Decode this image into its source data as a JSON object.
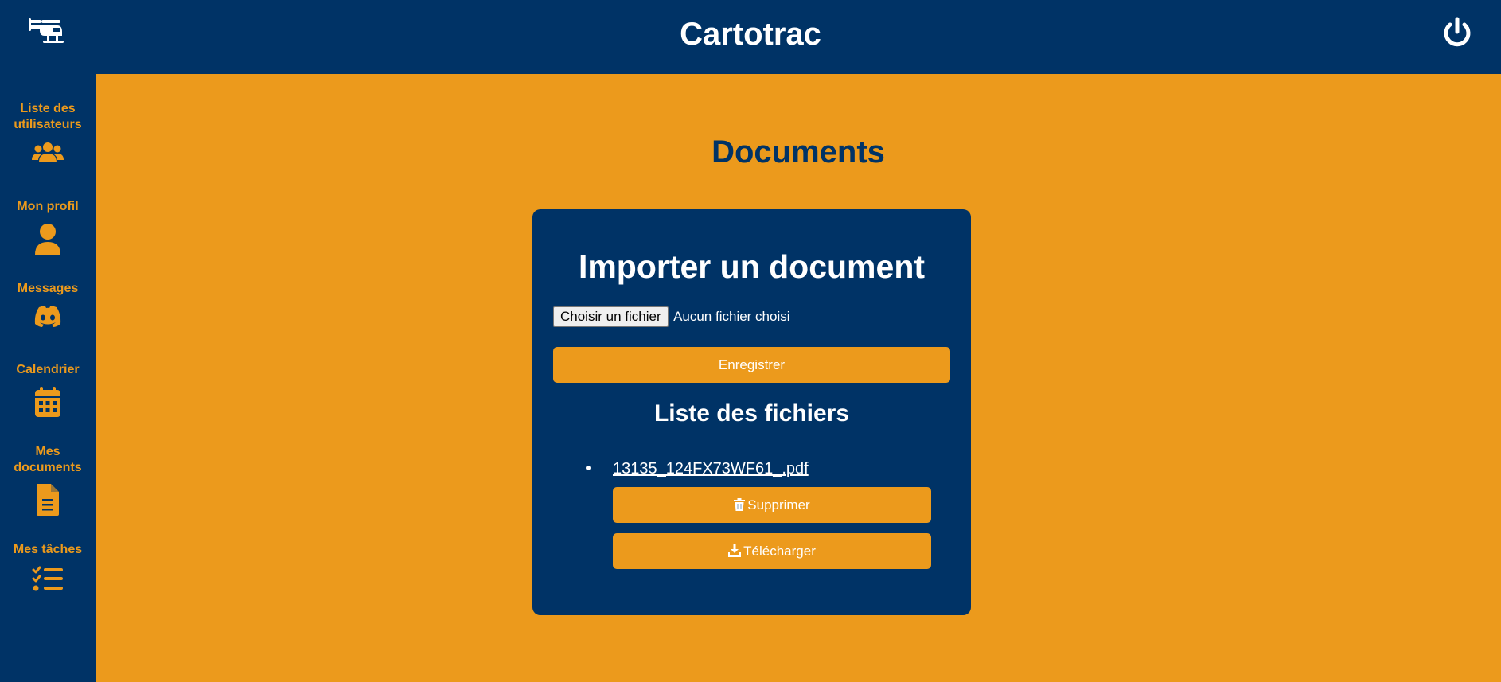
{
  "header": {
    "title": "Cartotrac",
    "logo_icon": "helicopter-icon",
    "power_icon": "power-icon"
  },
  "sidebar": {
    "items": [
      {
        "label": "Liste des utilisateurs",
        "icon": "users-icon"
      },
      {
        "label": "Mon profil",
        "icon": "user-icon"
      },
      {
        "label": "Messages",
        "icon": "discord-icon"
      },
      {
        "label": "Calendrier",
        "icon": "calendar-icon"
      },
      {
        "label": "Mes documents",
        "icon": "file-lines-icon"
      },
      {
        "label": "Mes tâches",
        "icon": "list-check-icon"
      }
    ]
  },
  "main": {
    "title": "Documents",
    "card": {
      "title": "Importer un document",
      "file_input": {
        "button_label": "Choisir un fichier",
        "status": "Aucun fichier choisi"
      },
      "save_label": "Enregistrer",
      "list_title": "Liste des fichiers",
      "files": [
        {
          "name": "13135_124FX73WF61_.pdf",
          "delete_label": "Supprimer",
          "delete_icon": "trash-icon",
          "download_label": "Télécharger",
          "download_icon": "download-icon"
        }
      ]
    }
  },
  "colors": {
    "navy": "#003366",
    "orange": "#ec9a1c",
    "white": "#ffffff"
  }
}
